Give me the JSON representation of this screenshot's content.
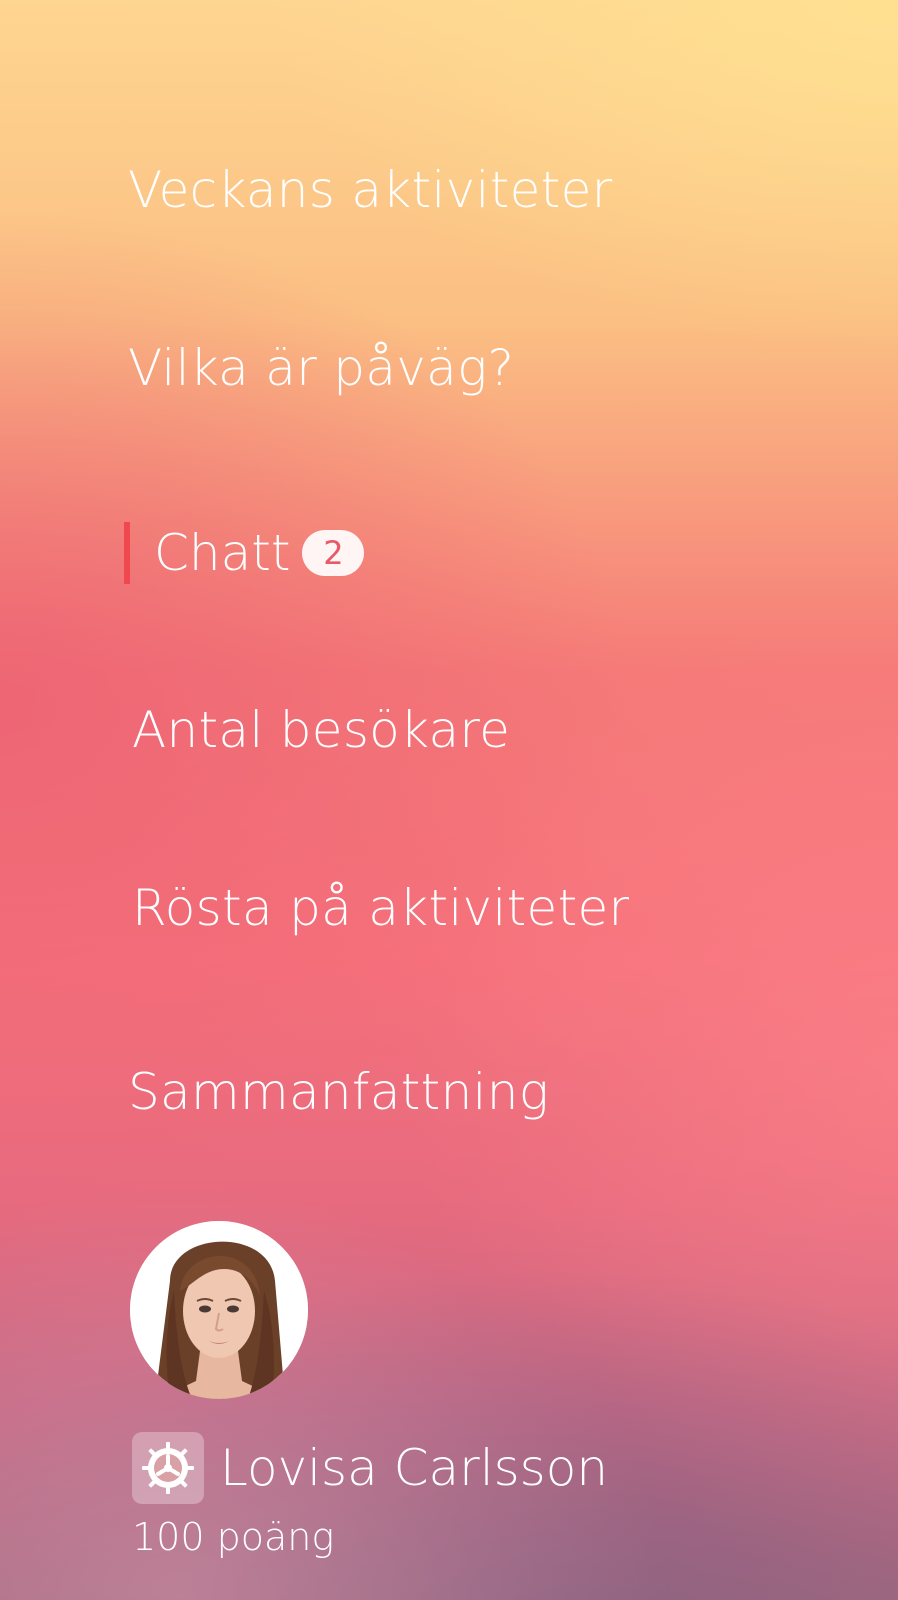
{
  "menu": {
    "items": [
      {
        "label": "Veckans aktiviteter"
      },
      {
        "label": "Vilka är påväg?"
      },
      {
        "label": "Chatt",
        "badge": "2",
        "active": true
      },
      {
        "label": "Antal besökare"
      },
      {
        "label": "Rösta på aktiviteter"
      },
      {
        "label": "Sammanfattning"
      }
    ]
  },
  "profile": {
    "name": "Lovisa Carlsson",
    "points": "100 poäng",
    "settings_icon": "gear-icon"
  },
  "colors": {
    "active_indicator": "#f0484f",
    "badge_text": "#e75a6a",
    "text": "#ffffff"
  }
}
